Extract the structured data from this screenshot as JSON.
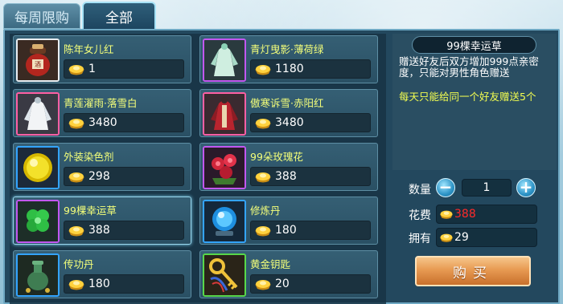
{
  "tabs": [
    {
      "label": "每周限购",
      "active": false
    },
    {
      "label": "全部",
      "active": true
    }
  ],
  "items": [
    {
      "name": "陈年女儿红",
      "price": "1",
      "frame": "white",
      "icon": "wine-jar-icon"
    },
    {
      "name": "青灯曳影·薄荷绿",
      "price": "1180",
      "frame": "purple",
      "icon": "costume-green-icon"
    },
    {
      "name": "青莲濯雨·落雪白",
      "price": "3480",
      "frame": "pink",
      "icon": "costume-white-icon"
    },
    {
      "name": "傲寒诉雪·赤阳红",
      "price": "3480",
      "frame": "pink",
      "icon": "costume-red-icon"
    },
    {
      "name": "外装染色剂",
      "price": "298",
      "frame": "blue",
      "icon": "dye-orb-icon"
    },
    {
      "name": "99朵玫瑰花",
      "price": "388",
      "frame": "purple",
      "icon": "roses-icon"
    },
    {
      "name": "99棵幸运草",
      "price": "388",
      "frame": "purple",
      "icon": "clover-icon"
    },
    {
      "name": "修炼丹",
      "price": "180",
      "frame": "blue",
      "icon": "crystal-ball-icon"
    },
    {
      "name": "传功丹",
      "price": "180",
      "frame": "blue",
      "icon": "green-vase-icon"
    },
    {
      "name": "黄金钥匙",
      "price": "20",
      "frame": "green",
      "icon": "golden-key-icon"
    }
  ],
  "detail": {
    "title": "99棵幸运草",
    "description": "赠送好友后双方增加999点亲密度，只能对男性角色赠送",
    "note": "每天只能给同一个好友赠送5个"
  },
  "quantity": {
    "label": "数量",
    "value": "1",
    "minus": "−",
    "plus": "+"
  },
  "cost": {
    "label": "花费",
    "value": "388",
    "color": "#ff2a2a"
  },
  "owned": {
    "label": "拥有",
    "value": "29",
    "color": "#ffffff"
  },
  "buy_button": {
    "label": "购买"
  },
  "colors": {
    "item_name": "#f4ff7a",
    "note": "#f4ff50"
  }
}
